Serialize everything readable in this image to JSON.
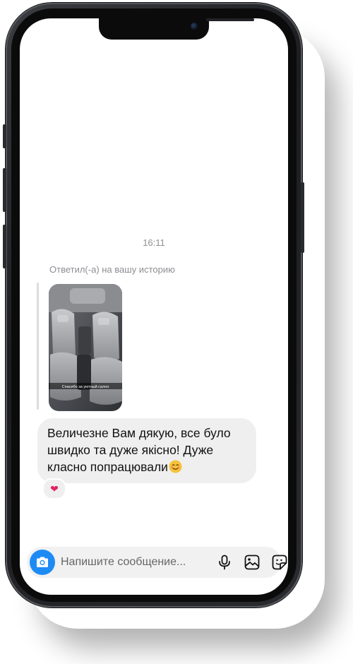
{
  "chat": {
    "timestamp": "16:11",
    "reply_note": "Ответил(-а) на вашу историю",
    "story_caption": "Спасибо за уютный салон",
    "message_text": "Величезне Вам дякую, все було швидко та дуже якісно! Дуже класно попрацювали",
    "message_emoji": "smiling-face-emoji",
    "reaction": "❤"
  },
  "composer": {
    "placeholder": "Напишите сообщение...",
    "camera_icon": "camera-icon",
    "mic_icon": "microphone-icon",
    "gallery_icon": "gallery-icon",
    "sticker_icon": "sticker-icon"
  },
  "colors": {
    "accent": "#1e8bf5",
    "bubble": "#efefef",
    "meta_text": "#8e8e93",
    "reaction": "#e0245e"
  }
}
